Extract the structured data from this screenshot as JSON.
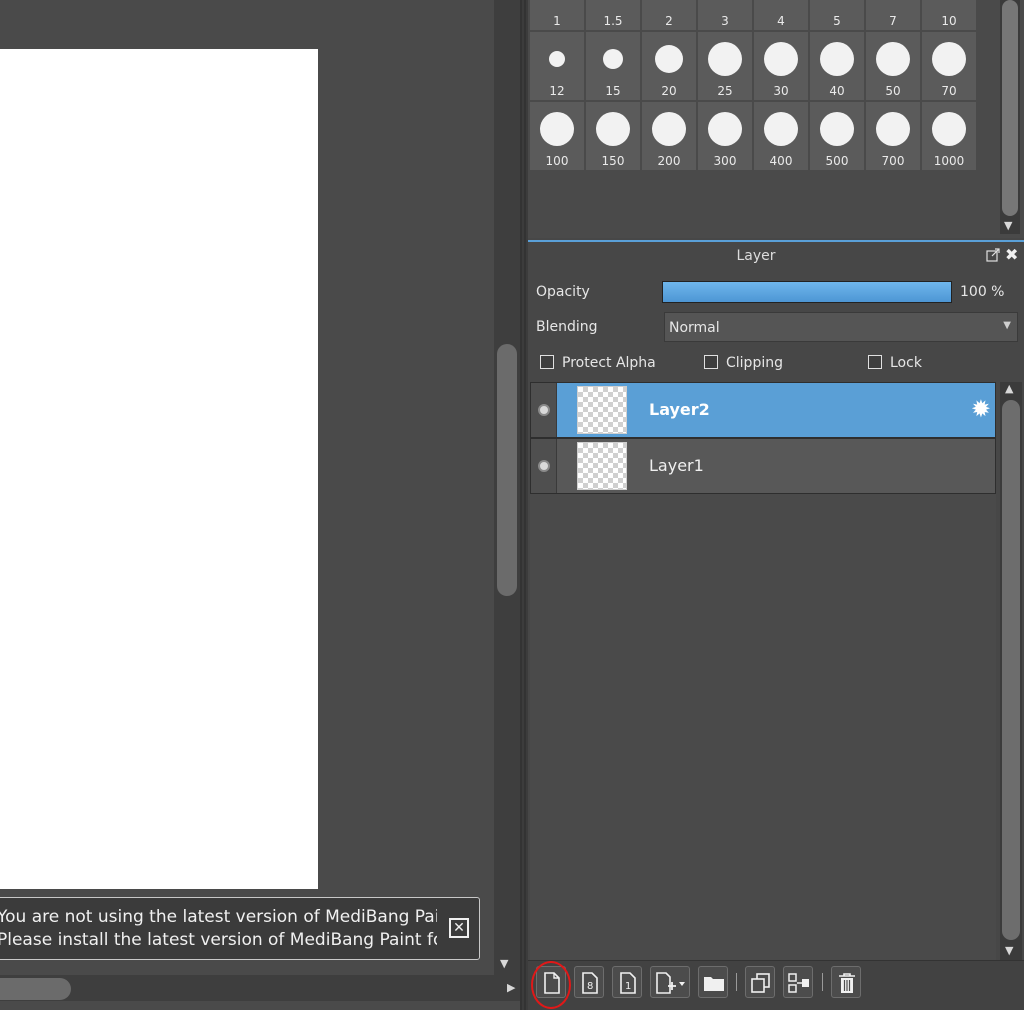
{
  "notice": {
    "line1": "You are not using the latest version of MediBang Paint.",
    "line2": "Please install the latest version of MediBang Paint found here.",
    "close_glyph": "✕"
  },
  "brush_sizes": {
    "row1": [
      "1",
      "1.5",
      "2",
      "3",
      "4",
      "5",
      "7",
      "10"
    ],
    "row2": [
      "12",
      "15",
      "20",
      "25",
      "30",
      "40",
      "50",
      "70"
    ],
    "row3": [
      "100",
      "150",
      "200",
      "300",
      "400",
      "500",
      "700",
      "1000"
    ]
  },
  "layer_panel": {
    "title": "Layer",
    "opacity_label": "Opacity",
    "opacity_percent": 100,
    "opacity_value": "100 %",
    "blending_label": "Blending",
    "blending_value": "Normal",
    "checkboxes": {
      "protect_alpha": "Protect Alpha",
      "clipping": "Clipping",
      "lock": "Lock"
    },
    "layers": [
      {
        "name": "Layer2",
        "selected": true
      },
      {
        "name": "Layer1",
        "selected": false
      }
    ]
  },
  "colors": {
    "accent": "#5a9fd6",
    "annotation_circle": "#e01818"
  },
  "icons": {
    "toolbar": [
      "new-layer-icon",
      "new-8bit-layer-icon",
      "new-1bit-layer-icon",
      "add-layer-dropdown-icon",
      "new-folder-icon",
      "duplicate-layer-icon",
      "merge-down-icon",
      "delete-layer-icon"
    ]
  }
}
